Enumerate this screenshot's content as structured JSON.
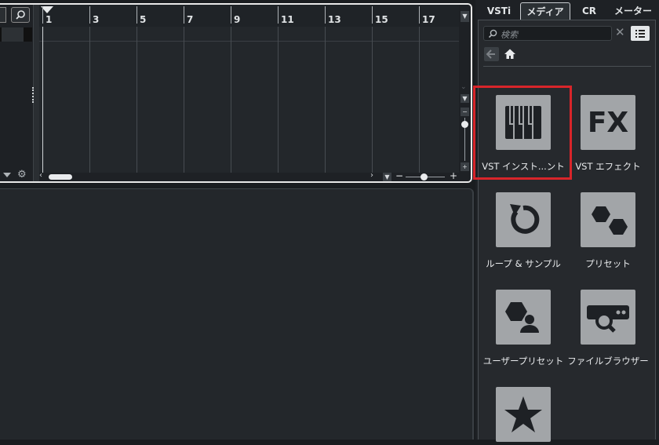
{
  "project": {
    "bar_numbers": [
      "1",
      "3",
      "5",
      "7",
      "9",
      "11",
      "13",
      "15",
      "17"
    ]
  },
  "right_zone": {
    "tabs": [
      {
        "label": "VSTi",
        "active": false
      },
      {
        "label": "メディア",
        "active": true
      },
      {
        "label": "CR",
        "active": false
      },
      {
        "label": "メーター",
        "active": false
      }
    ],
    "search": {
      "placeholder": "検索",
      "clear_glyph": "✕"
    },
    "tiles": [
      {
        "label": "VST インスト...ント",
        "icon": "piano-keys-icon",
        "selected": true
      },
      {
        "label": "VST エフェクト",
        "icon": "fx-icon",
        "icon_text": "FX"
      },
      {
        "label": "ループ & サンプル",
        "icon": "loop-icon"
      },
      {
        "label": "プリセット",
        "icon": "hexagons-icon"
      },
      {
        "label": "ユーザープリセット",
        "icon": "user-preset-icon"
      },
      {
        "label": "ファイルブラウザー",
        "icon": "file-browser-icon"
      },
      {
        "label": "",
        "icon": "star-icon"
      }
    ],
    "highlight_color": "#d8252a"
  }
}
